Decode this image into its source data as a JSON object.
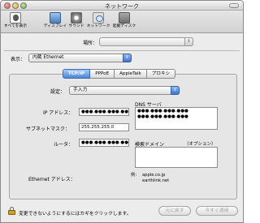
{
  "window": {
    "title": "ネットワーク"
  },
  "toolbar": {
    "items": [
      {
        "label": "すべてを表示",
        "icon": "show-all-icon"
      },
      {
        "label": "ディスプレイ",
        "icon": "display-icon"
      },
      {
        "label": "サウンド",
        "icon": "sound-icon"
      },
      {
        "label": "ネットワーク",
        "icon": "network-icon"
      },
      {
        "label": "起動ディスク",
        "icon": "startup-disk-icon"
      }
    ]
  },
  "location": {
    "label": "場所：",
    "value": ""
  },
  "show": {
    "label": "表示：",
    "value": "内蔵 Ethernet"
  },
  "tabs": [
    {
      "label": "TCP/IP",
      "active": true
    },
    {
      "label": "PPPoE",
      "active": false
    },
    {
      "label": "AppleTalk",
      "active": false
    },
    {
      "label": "プロキシ",
      "active": false
    }
  ],
  "tcpip": {
    "configure": {
      "label": "設定：",
      "value": "手入力"
    },
    "ip": {
      "label": "IP アドレス：",
      "value": "●●●.●●●.●●●.●●●"
    },
    "subnet": {
      "label": "サブネットマスク：",
      "value": "255.255.255.0"
    },
    "router": {
      "label": "ルータ：",
      "value": "●●●.●●●.●●●.●●●"
    },
    "ethernet": {
      "label": "Ethernet アドレス：",
      "value": ""
    },
    "dns": {
      "label": "DNS サーバ",
      "lines": [
        "●●●.●●●.●●●.●●●",
        "●●●.●●●.●●●.●●●"
      ]
    },
    "search_domains": {
      "label": "検索ドメイン",
      "optional": "（オプション）",
      "value": ""
    },
    "example": {
      "label": "例：",
      "lines": [
        "apple.co.jp",
        "earthlink.net"
      ]
    }
  },
  "footer": {
    "lock_text": "変更できないようにするにはカギをクリックします。",
    "revert_label": "元に戻す",
    "apply_label": "今すぐ適用"
  },
  "colors": {
    "accent": "#4c86d8",
    "window_bg": "#ececec",
    "disabled_text": "#a0a0a0"
  }
}
